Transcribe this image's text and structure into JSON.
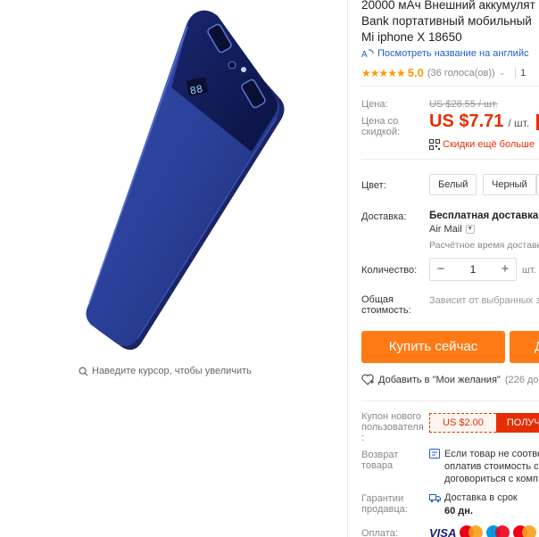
{
  "product": {
    "title_lines": [
      "20000 мАч Внешний аккумулят",
      "Bank портативный мобильный",
      "Mi iphone X 18650"
    ],
    "image_icon": "power-bank-product-image",
    "zoom_hint": "Наведите курсор, чтобы увеличить",
    "translate_link": "Посмотреть название на английс",
    "rating": {
      "stars": "★★★★★",
      "value": "5.0",
      "votes": "(36 голоса(ов))",
      "orders_prefix": "1"
    }
  },
  "price": {
    "label": "Цена:",
    "old": "US $28.55 / шт.",
    "discount_label_line1": "Цена со",
    "discount_label_line2": "скидкой:",
    "new_amount": "US $7.71",
    "unit": "/ шт.",
    "more_discounts": "Скидки ещё больше"
  },
  "color": {
    "label": "Цвет:",
    "options": [
      "Белый",
      "Черный"
    ]
  },
  "shipping": {
    "label": "Доставка:",
    "main": "Бесплатная доставка в",
    "method": "Air Mail",
    "time": "Расчётное время доставк"
  },
  "quantity": {
    "label": "Количество:",
    "minus": "−",
    "value": "1",
    "plus": "+",
    "unit": "шт. (",
    "total_label_line1": "Общая",
    "total_label_line2": "стоимость:",
    "total_value": "Зависит от выбранных з"
  },
  "actions": {
    "buy_now": "Купить сейчас",
    "add_to_cart": "Д",
    "wishlist": "Добавить в \"Мои желания\"",
    "wishlist_count": "(226 до"
  },
  "coupon": {
    "label_line1": "Купон нового",
    "label_line2": "пользователя",
    "label_line3": ":",
    "value": "US $2.00",
    "get": "ПОЛУЧ"
  },
  "returns": {
    "label_line1": "Возврат",
    "label_line2": "товара",
    "text_lines": [
      "Если товар не соотве",
      "оплатив стоимость с",
      "договориться с комп"
    ]
  },
  "guarantee": {
    "label_line1": "Гарантии",
    "label_line2": "продавца:",
    "text": "Доставка в срок",
    "days": "60 дн."
  },
  "payment": {
    "label": "Оплата:",
    "visa": "VISA"
  },
  "colors": {
    "accent_orange": "#ff7a14",
    "price_red": "#e62e04",
    "link_blue": "#1e5fc8",
    "star_orange": "#ff9a00"
  }
}
